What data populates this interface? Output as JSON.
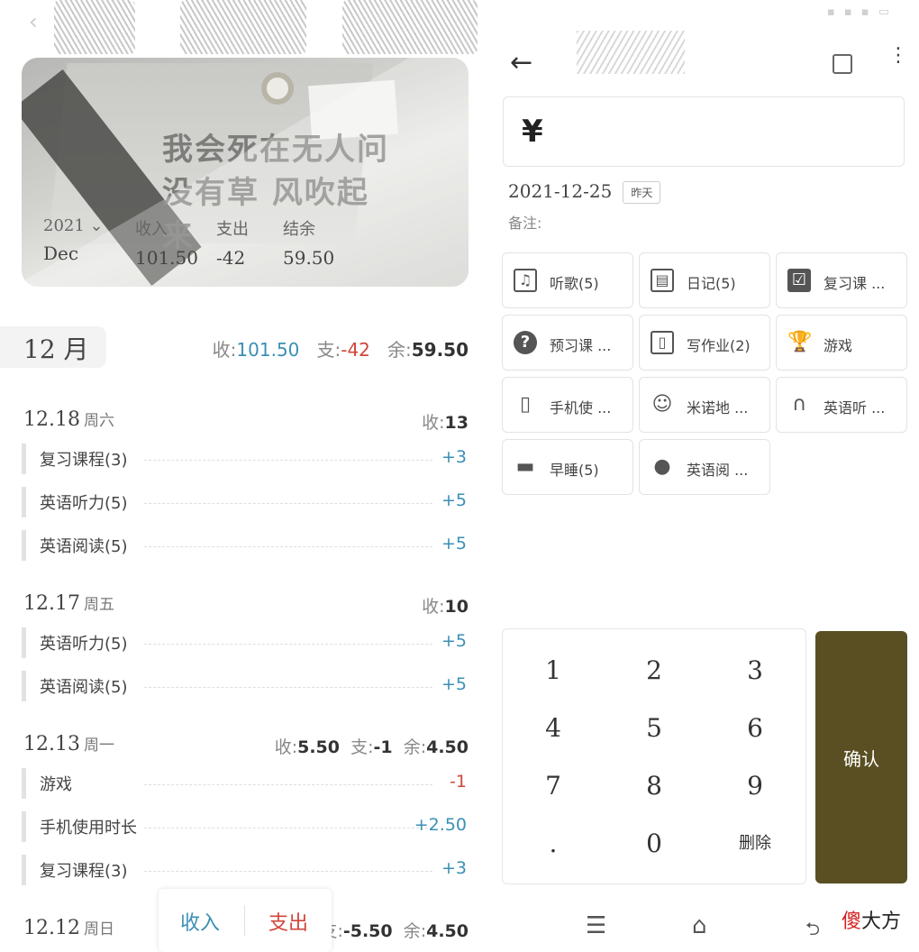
{
  "left": {
    "banner": {
      "handwriting": "我会死在无人问\n没有草 风吹起\n来",
      "year": "2021",
      "year_arrow": "⌄",
      "month": "Dec",
      "income_label": "收入",
      "income_value": "101.50",
      "expense_label": "支出",
      "expense_value": "-42",
      "balance_label": "结余",
      "balance_value": "59.50"
    },
    "month_label": "12 月",
    "summary": {
      "income_prefix": "收:",
      "income_value": "101.50",
      "expense_prefix": "支:",
      "expense_value": "-42",
      "balance_prefix": "余:",
      "balance_value": "59.50"
    },
    "days": [
      {
        "date": "12.18",
        "weekday": "周六",
        "sum": [
          {
            "prefix": "收:",
            "value": "13"
          }
        ],
        "entries": [
          {
            "name": "复习课程(3)",
            "amount": "+3"
          },
          {
            "name": "英语听力(5)",
            "amount": "+5"
          },
          {
            "name": "英语阅读(5)",
            "amount": "+5"
          }
        ]
      },
      {
        "date": "12.17",
        "weekday": "周五",
        "sum": [
          {
            "prefix": "收:",
            "value": "10"
          }
        ],
        "entries": [
          {
            "name": "英语听力(5)",
            "amount": "+5"
          },
          {
            "name": "英语阅读(5)",
            "amount": "+5"
          }
        ]
      },
      {
        "date": "12.13",
        "weekday": "周一",
        "sum": [
          {
            "prefix": "收:",
            "value": "5.50"
          },
          {
            "prefix": "支:",
            "value": "-1"
          },
          {
            "prefix": "余:",
            "value": "4.50"
          }
        ],
        "entries": [
          {
            "name": "游戏",
            "amount": "-1"
          },
          {
            "name": "手机使用时长",
            "amount": "+2.50"
          },
          {
            "name": "复习课程(3)",
            "amount": "+3"
          }
        ]
      },
      {
        "date": "12.12",
        "weekday": "周日",
        "sum": [
          {
            "prefix": "支:",
            "value": "-5.50"
          },
          {
            "prefix": "余:",
            "value": "4.50"
          }
        ],
        "entries": []
      }
    ],
    "fab": {
      "income": "收入",
      "expense": "支出"
    }
  },
  "right": {
    "back": "←",
    "more": "⋮",
    "currency": "¥",
    "date": "2021-12-25",
    "date_tag": "昨天",
    "remark": "备注:",
    "categories": [
      {
        "label": "听歌(5)",
        "icon": "music-note-icon"
      },
      {
        "label": "日记(5)",
        "icon": "book-icon"
      },
      {
        "label": "复习课 ...",
        "icon": "checkbox-icon"
      },
      {
        "label": "预习课 ...",
        "icon": "question-icon"
      },
      {
        "label": "写作业(2)",
        "icon": "open-book-icon"
      },
      {
        "label": "游戏",
        "icon": "trophy-icon"
      },
      {
        "label": "手机使 ...",
        "icon": "phone-icon"
      },
      {
        "label": "米诺地 ...",
        "icon": "face-icon"
      },
      {
        "label": "英语听 ...",
        "icon": "headphones-icon"
      },
      {
        "label": "早睡(5)",
        "icon": "bed-icon"
      },
      {
        "label": "英语阅 ...",
        "icon": "apple-icon"
      }
    ],
    "keys": [
      "1",
      "2",
      "3",
      "4",
      "5",
      "6",
      "7",
      "8",
      "9",
      ".",
      "0",
      "删除"
    ],
    "confirm": "确认",
    "nav": {
      "menu": "☰",
      "home": "⌂",
      "back": "⮌"
    },
    "watermark_red": "傻",
    "watermark_black": "大方"
  },
  "colors": {
    "income": "#3b8fb5",
    "expense": "#d0463b",
    "confirm_bg": "#5a4f22"
  }
}
